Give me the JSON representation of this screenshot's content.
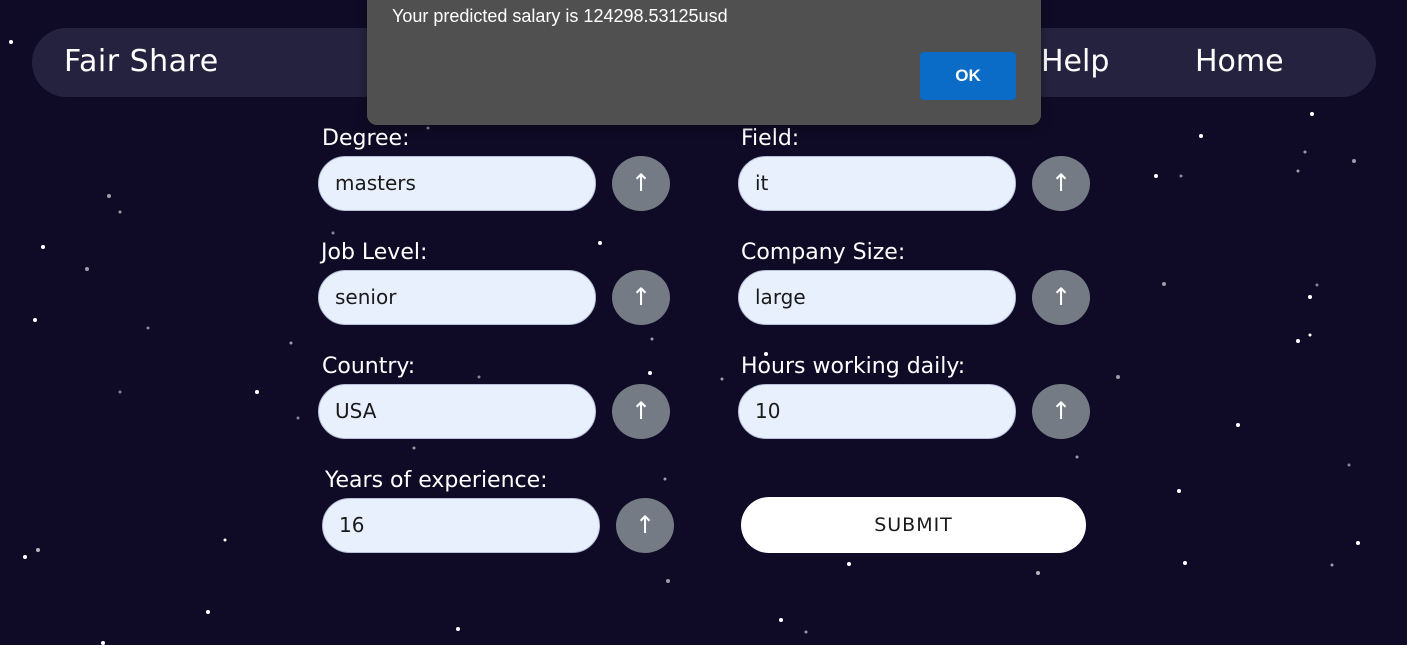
{
  "nav": {
    "brand": "Fair Share",
    "links": [
      "Help",
      "Home"
    ]
  },
  "form": {
    "fields": [
      {
        "label": "Degree:",
        "value": "masters"
      },
      {
        "label": "Field:",
        "value": "it"
      },
      {
        "label": "Job Level:",
        "value": "senior"
      },
      {
        "label": "Company Size:",
        "value": "large"
      },
      {
        "label": "Country:",
        "value": "USA"
      },
      {
        "label": "Hours working daily:",
        "value": "10"
      },
      {
        "label": "Years of experience:",
        "value": "16"
      }
    ],
    "arrow_glyph": "↑",
    "submit_label": "SUBMIT"
  },
  "dialog": {
    "message": "Your predicted salary is 124298.53125usd",
    "ok_label": "OK"
  },
  "colors": {
    "background": "#0f0b26",
    "navbar": "#25223f",
    "input_bg": "#e8f0fe",
    "arrow_button": "#747b84",
    "dialog_bg": "#505050",
    "dialog_ok": "#0a6cc7"
  }
}
